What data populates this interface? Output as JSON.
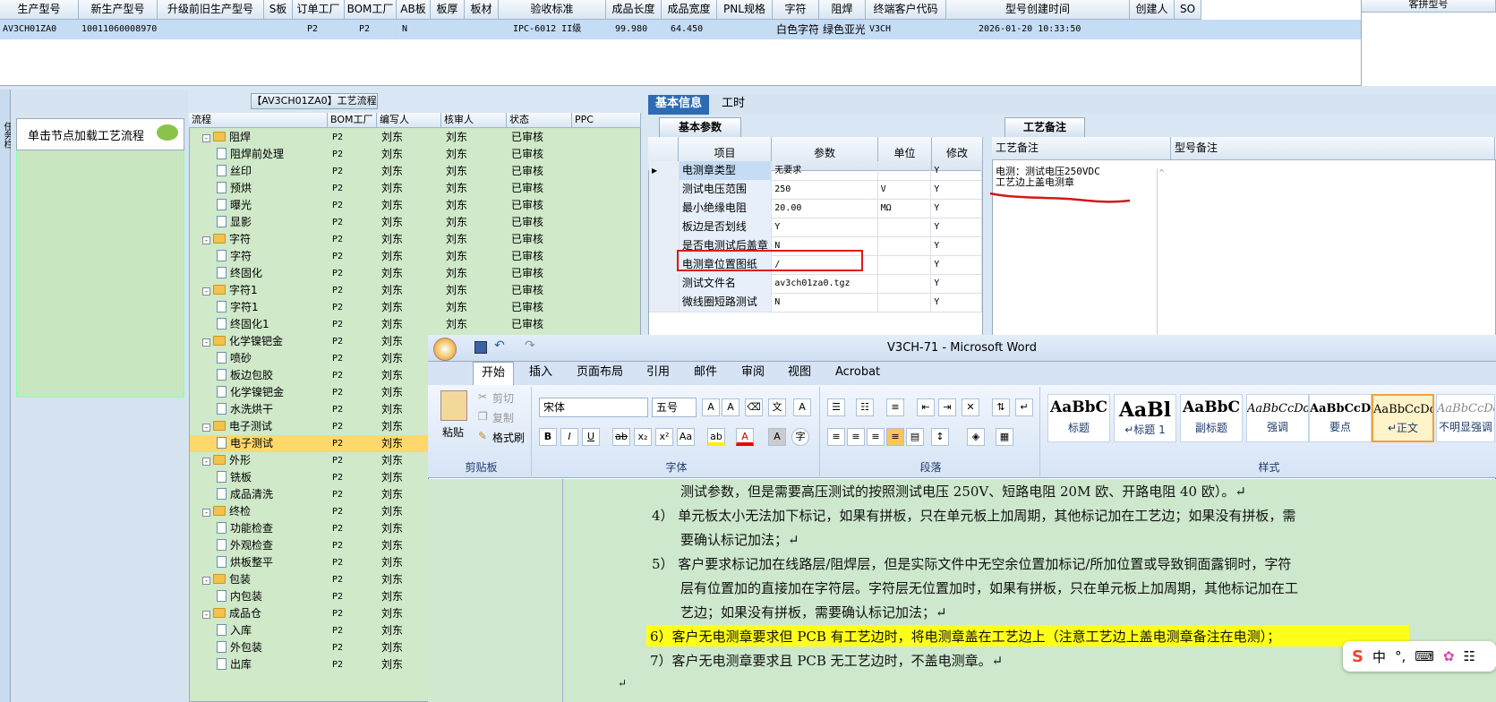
{
  "top_grid": {
    "headers": [
      "生产型号",
      "新生产型号",
      "升级前旧生产型号",
      "S板",
      "订单工厂",
      "BOM工厂",
      "AB板",
      "板厚",
      "板材",
      "验收标准",
      "成品长度",
      "成品宽度",
      "PNL规格",
      "字符",
      "阻焊",
      "终端客户代码",
      "型号创建时间",
      "创建人",
      "SO"
    ],
    "row": [
      "AV3CH01ZA0",
      "10011060008970",
      "",
      "",
      "P2",
      "P2",
      "N",
      "",
      "",
      "IPC-6012 II级",
      "99.980",
      "64.450",
      "",
      "白色字符",
      "绿色亚光",
      "V3CH",
      "2026-01-20 10:33:50",
      "",
      ""
    ],
    "right_header": "客拼型号"
  },
  "left_panel": {
    "strip_label": "任务栏",
    "load_label": "单击节点加载工艺流程"
  },
  "tree": {
    "title": "【AV3CH01ZA0】工艺流程",
    "headers": [
      "流程",
      "BOM工厂",
      "编写人",
      "核审人",
      "状态",
      "PPC"
    ],
    "rows": [
      {
        "name": "阻焊",
        "type": "folder",
        "bom": "P2",
        "author": "刘东",
        "reviewer": "刘东",
        "status": "已审核"
      },
      {
        "name": "阻焊前处理",
        "type": "doc",
        "bom": "P2",
        "author": "刘东",
        "reviewer": "刘东",
        "status": "已审核"
      },
      {
        "name": "丝印",
        "type": "doc",
        "bom": "P2",
        "author": "刘东",
        "reviewer": "刘东",
        "status": "已审核"
      },
      {
        "name": "预烘",
        "type": "doc",
        "bom": "P2",
        "author": "刘东",
        "reviewer": "刘东",
        "status": "已审核"
      },
      {
        "name": "曝光",
        "type": "doc",
        "bom": "P2",
        "author": "刘东",
        "reviewer": "刘东",
        "status": "已审核"
      },
      {
        "name": "显影",
        "type": "doc",
        "bom": "P2",
        "author": "刘东",
        "reviewer": "刘东",
        "status": "已审核"
      },
      {
        "name": "字符",
        "type": "folder",
        "bom": "P2",
        "author": "刘东",
        "reviewer": "刘东",
        "status": "已审核"
      },
      {
        "name": "字符",
        "type": "doc",
        "bom": "P2",
        "author": "刘东",
        "reviewer": "刘东",
        "status": "已审核"
      },
      {
        "name": "终固化",
        "type": "doc",
        "bom": "P2",
        "author": "刘东",
        "reviewer": "刘东",
        "status": "已审核"
      },
      {
        "name": "字符1",
        "type": "folder",
        "bom": "P2",
        "author": "刘东",
        "reviewer": "刘东",
        "status": "已审核"
      },
      {
        "name": "字符1",
        "type": "doc",
        "bom": "P2",
        "author": "刘东",
        "reviewer": "刘东",
        "status": "已审核"
      },
      {
        "name": "终固化1",
        "type": "doc",
        "bom": "P2",
        "author": "刘东",
        "reviewer": "刘东",
        "status": "已审核"
      },
      {
        "name": "化学镍钯金",
        "type": "folder",
        "bom": "P2",
        "author": "刘东",
        "reviewer": "",
        "status": ""
      },
      {
        "name": "喷砂",
        "type": "doc",
        "bom": "P2",
        "author": "刘东",
        "reviewer": "",
        "status": ""
      },
      {
        "name": "板边包胶",
        "type": "doc",
        "bom": "P2",
        "author": "刘东",
        "reviewer": "",
        "status": ""
      },
      {
        "name": "化学镍钯金",
        "type": "doc",
        "bom": "P2",
        "author": "刘东",
        "reviewer": "",
        "status": ""
      },
      {
        "name": "水洗烘干",
        "type": "doc",
        "bom": "P2",
        "author": "刘东",
        "reviewer": "",
        "status": ""
      },
      {
        "name": "电子测试",
        "type": "folder",
        "bom": "P2",
        "author": "刘东",
        "reviewer": "",
        "status": ""
      },
      {
        "name": "电子测试",
        "type": "doc",
        "bom": "P2",
        "author": "刘东",
        "reviewer": "",
        "status": "",
        "selected": true
      },
      {
        "name": "外形",
        "type": "folder",
        "bom": "P2",
        "author": "刘东",
        "reviewer": "",
        "status": ""
      },
      {
        "name": "铣板",
        "type": "doc",
        "bom": "P2",
        "author": "刘东",
        "reviewer": "",
        "status": ""
      },
      {
        "name": "成品清洗",
        "type": "doc",
        "bom": "P2",
        "author": "刘东",
        "reviewer": "",
        "status": ""
      },
      {
        "name": "终检",
        "type": "folder",
        "bom": "P2",
        "author": "刘东",
        "reviewer": "",
        "status": ""
      },
      {
        "name": "功能检查",
        "type": "doc",
        "bom": "P2",
        "author": "刘东",
        "reviewer": "",
        "status": ""
      },
      {
        "name": "外观检查",
        "type": "doc",
        "bom": "P2",
        "author": "刘东",
        "reviewer": "",
        "status": ""
      },
      {
        "name": "烘板整平",
        "type": "doc",
        "bom": "P2",
        "author": "刘东",
        "reviewer": "",
        "status": ""
      },
      {
        "name": "包装",
        "type": "folder",
        "bom": "P2",
        "author": "刘东",
        "reviewer": "",
        "status": ""
      },
      {
        "name": "内包装",
        "type": "doc",
        "bom": "P2",
        "author": "刘东",
        "reviewer": "",
        "status": ""
      },
      {
        "name": "成品仓",
        "type": "folder",
        "bom": "P2",
        "author": "刘东",
        "reviewer": "",
        "status": ""
      },
      {
        "name": "入库",
        "type": "doc",
        "bom": "P2",
        "author": "刘东",
        "reviewer": "",
        "status": ""
      },
      {
        "name": "外包装",
        "type": "doc",
        "bom": "P2",
        "author": "刘东",
        "reviewer": "",
        "status": ""
      },
      {
        "name": "出库",
        "type": "doc",
        "bom": "P2",
        "author": "刘东",
        "reviewer": "",
        "status": ""
      }
    ]
  },
  "tabs": {
    "basic_info": "基本信息",
    "craft": "工时"
  },
  "params": {
    "tab_label": "基本参数",
    "headers": [
      "项目",
      "参数",
      "单位",
      "修改"
    ],
    "rows": [
      {
        "item": "电测章类型",
        "value": "无要求",
        "unit": "",
        "edit": "Y"
      },
      {
        "item": "测试电压范围",
        "value": "250",
        "unit": "V",
        "edit": "Y"
      },
      {
        "item": "最小绝缘电阻",
        "value": "20.00",
        "unit": "MΩ",
        "edit": "Y"
      },
      {
        "item": "板边是否划线",
        "value": "Y",
        "unit": "",
        "edit": "Y"
      },
      {
        "item": "是否电测试后盖章",
        "value": "N",
        "unit": "",
        "edit": "Y"
      },
      {
        "item": "电测章位置图纸",
        "value": "/",
        "unit": "",
        "edit": "Y"
      },
      {
        "item": "测试文件名",
        "value": "av3ch01za0.tgz",
        "unit": "",
        "edit": "Y"
      },
      {
        "item": "微线圈短路测试",
        "value": "N",
        "unit": "",
        "edit": "Y"
      }
    ]
  },
  "notes": {
    "tab_label": "工艺备注",
    "headers": [
      "工艺备注",
      "型号备注"
    ],
    "line1": "电测：测试电压250VDC",
    "line2": "工艺边上盖电测章"
  },
  "word": {
    "title": "V3CH-71 - Microsoft Word",
    "tabs": [
      "开始",
      "插入",
      "页面布局",
      "引用",
      "邮件",
      "审阅",
      "视图",
      "Acrobat"
    ],
    "clipboard": {
      "paste": "粘贴",
      "cut": "剪切",
      "copy": "复制",
      "format": "格式刷",
      "label": "剪贴板"
    },
    "font": {
      "name": "宋体",
      "size": "五号",
      "label": "字体"
    },
    "paragraph_label": "段落",
    "styles": [
      {
        "sample": "AaBbC",
        "name": "标题"
      },
      {
        "sample": "AaBl",
        "name": "↵标题 1"
      },
      {
        "sample": "AaBbC",
        "name": "副标题"
      },
      {
        "sample": "AaBbCcDd",
        "name": "强调"
      },
      {
        "sample": "AaBbCcD",
        "name": "要点"
      },
      {
        "sample": "AaBbCcDd",
        "name": "↵正文"
      },
      {
        "sample": "AaBbCcDd",
        "name": "不明显强调"
      }
    ],
    "styles_label": "样式",
    "doc_lines": [
      "测试参数，但是需要高压测试的按照测试电压 250V、短路电阻 20M 欧、开路电阻 40 欧）。↵",
      "4） 单元板太小无法加下标记，如果有拼板，只在单元板上加周期，其他标记加在工艺边；如果没有拼板，需",
      "要确认标记加法；↵",
      "5） 客户要求标记加在线路层/阻焊层，但是实际文件中无空余位置加标记/所加位置或导致铜面露铜时，字符",
      "层有位置加的直接加在字符层。字符层无位置加时，如果有拼板，只在单元板上加周期，其他标记加在工",
      "艺边；如果没有拼板，需要确认标记加法；↵",
      "6）客户无电测章要求但 PCB 有工艺边时，将电测章盖在工艺边上（注意工艺边上盖电测章备注在电测）；",
      "7）客户无电测章要求且 PCB 无工艺边时，不盖电测章。↵",
      "↵"
    ]
  },
  "ime": {
    "logo": "S",
    "mode": "中"
  }
}
